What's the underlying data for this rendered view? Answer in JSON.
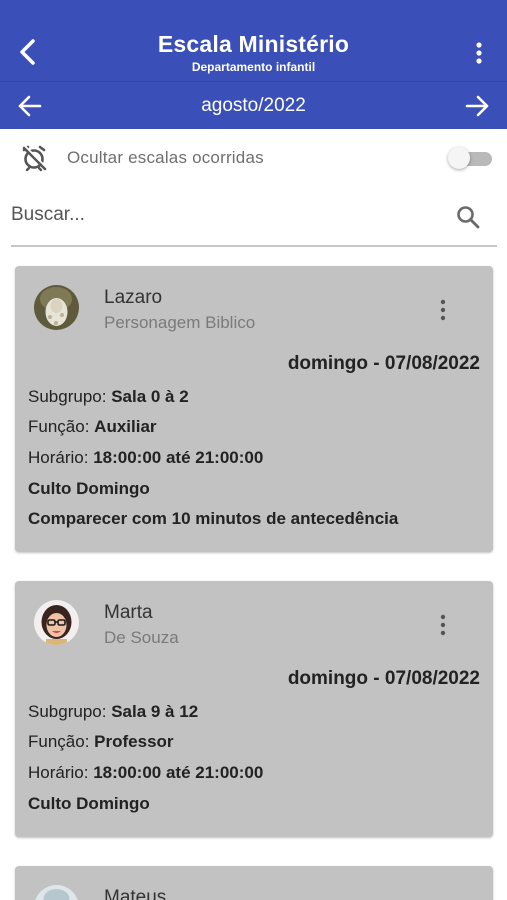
{
  "header": {
    "title": "Escala Ministério",
    "subtitle": "Departamento infantil",
    "back_icon": "arrow-back-ios-icon",
    "menu_icon": "more-vert-icon",
    "color": "#3b4fb8"
  },
  "month_nav": {
    "label": "agosto/2022",
    "prev_icon": "arrow-left-icon",
    "next_icon": "arrow-right-icon"
  },
  "filter": {
    "label": "Ocultar escalas ocorridas",
    "icon": "alarm-off-icon",
    "toggle_on": false
  },
  "search": {
    "placeholder": "Buscar...",
    "icon": "search-icon"
  },
  "cards": [
    {
      "name": "Lazaro",
      "surname": "Personagem Biblico",
      "date": "domingo - 07/08/2022",
      "subgroup_label": "Subgrupo:",
      "subgroup": "Sala 0 à 2",
      "role_label": "Função:",
      "role": "Auxiliar",
      "time_label": "Horário:",
      "time": "18:00:00 até 21:00:00",
      "event": "Culto Domingo",
      "note": "Comparecer com 10 minutos de antecedência"
    },
    {
      "name": "Marta",
      "surname": "De Souza",
      "date": "domingo - 07/08/2022",
      "subgroup_label": "Subgrupo:",
      "subgroup": "Sala 9 à 12",
      "role_label": "Função:",
      "role": "Professor",
      "time_label": "Horário:",
      "time": "18:00:00 até 21:00:00",
      "event": "Culto Domingo"
    },
    {
      "name": "Mateus"
    }
  ]
}
